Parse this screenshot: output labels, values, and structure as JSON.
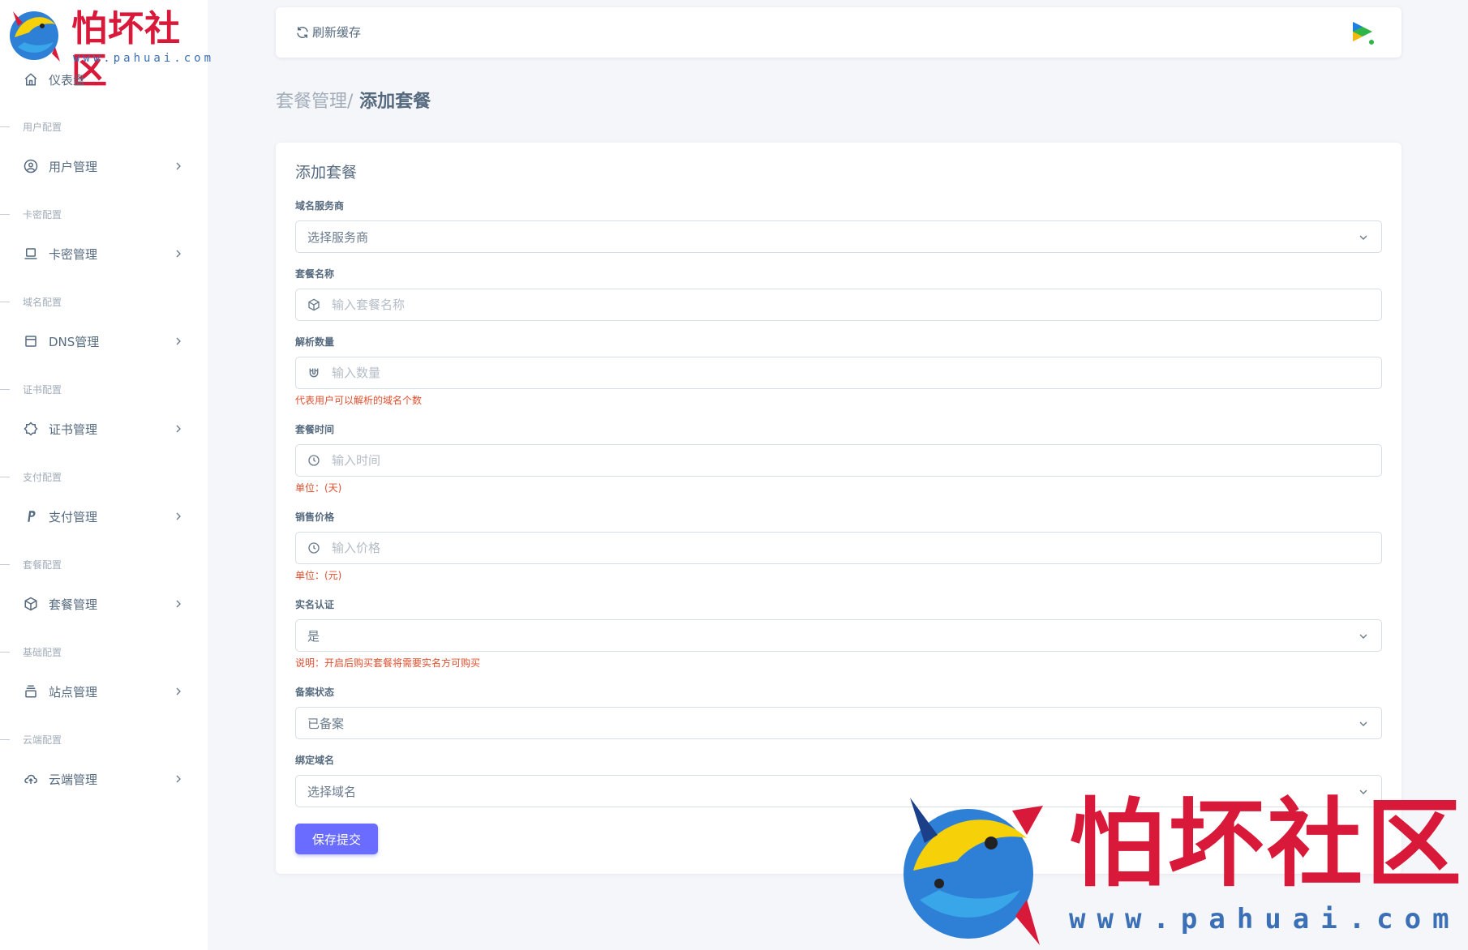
{
  "brand": {
    "title": "怕坏社区",
    "url": "www.pahuai.com"
  },
  "sidebar": {
    "dashboard": "仪表盘",
    "sections": [
      {
        "header": "用户配置",
        "label": "用户管理",
        "icon": "user-circle-icon"
      },
      {
        "header": "卡密配置",
        "label": "卡密管理",
        "icon": "laptop-icon"
      },
      {
        "header": "域名配置",
        "label": "DNS管理",
        "icon": "window-icon"
      },
      {
        "header": "证书配置",
        "label": "证书管理",
        "icon": "badge-icon"
      },
      {
        "header": "支付配置",
        "label": "支付管理",
        "icon": "paypal-icon"
      },
      {
        "header": "套餐配置",
        "label": "套餐管理",
        "icon": "cube-icon"
      },
      {
        "header": "基础配置",
        "label": "站点管理",
        "icon": "archive-icon"
      },
      {
        "header": "云端配置",
        "label": "云端管理",
        "icon": "cloud-upload-icon"
      }
    ]
  },
  "navbar": {
    "refresh_label": "刷新缓存"
  },
  "breadcrumb": {
    "parent": "套餐管理/",
    "current": " 添加套餐"
  },
  "form": {
    "title": "添加套餐",
    "provider": {
      "label": "域名服务商",
      "value": "选择服务商"
    },
    "name": {
      "label": "套餐名称",
      "placeholder": "输入套餐名称"
    },
    "count": {
      "label": "解析数量",
      "placeholder": "输入数量",
      "hint": "代表用户可以解析的域名个数"
    },
    "duration": {
      "label": "套餐时间",
      "placeholder": "输入时间",
      "hint": "单位：(天)"
    },
    "price": {
      "label": "销售价格",
      "placeholder": "输入价格",
      "hint": "单位：(元)"
    },
    "realname": {
      "label": "实名认证",
      "value": "是",
      "hint": "说明：开启后购买套餐将需要实名方可购买"
    },
    "icp": {
      "label": "备案状态",
      "value": "已备案"
    },
    "domain": {
      "label": "绑定域名",
      "value": "选择域名"
    },
    "submit_label": "保存提交"
  },
  "colors": {
    "primary": "#696cff",
    "hint": "#e04f2e",
    "brand_red": "#d8193a",
    "brand_blue": "#3b6fb6"
  }
}
